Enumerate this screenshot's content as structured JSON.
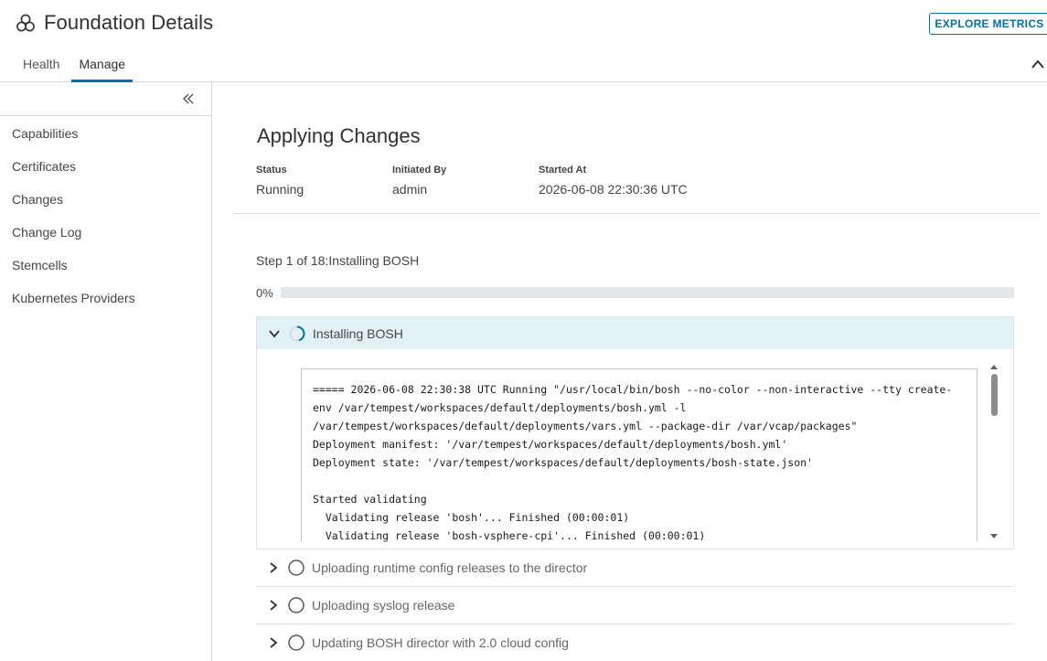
{
  "header": {
    "title": "Foundation Details",
    "explore_label": "EXPLORE METRICS",
    "tabs": [
      {
        "label": "Health",
        "active": false
      },
      {
        "label": "Manage",
        "active": true
      }
    ]
  },
  "sidebar": {
    "items": [
      {
        "label": "Capabilities"
      },
      {
        "label": "Certificates"
      },
      {
        "label": "Changes"
      },
      {
        "label": "Change Log"
      },
      {
        "label": "Stemcells"
      },
      {
        "label": "Kubernetes Providers"
      }
    ]
  },
  "main": {
    "title": "Applying Changes",
    "status_label": "Status",
    "status_value": "Running",
    "initiated_label": "Initiated By",
    "initiated_value": "admin",
    "started_label": "Started At",
    "started_value": "2026-06-08 22:30:36 UTC",
    "step_text": "Step 1 of 18:Installing BOSH",
    "progress_label": "0%",
    "progress_fraction": 0
  },
  "steps": {
    "active": {
      "label": "Installing BOSH",
      "status_icon": "spinner-icon",
      "log_lines": [
        "===== 2026-06-08 22:30:38 UTC Running \"/usr/local/bin/bosh --no-color --non-interactive --tty create-",
        "env /var/tempest/workspaces/default/deployments/bosh.yml -l",
        "/var/tempest/workspaces/default/deployments/vars.yml --package-dir /var/vcap/packages\"",
        "Deployment manifest: '/var/tempest/workspaces/default/deployments/bosh.yml'",
        "Deployment state: '/var/tempest/workspaces/default/deployments/bosh-state.json'",
        "",
        "Started validating",
        "  Validating release 'bosh'... Finished (00:00:01)",
        "  Validating release 'bosh-vsphere-cpi'... Finished (00:00:01)"
      ]
    },
    "pending": [
      {
        "label": "Uploading runtime config releases to the director"
      },
      {
        "label": "Uploading syslog release"
      },
      {
        "label": "Updating BOSH director with 2.0 cloud config"
      }
    ]
  },
  "colors": {
    "accent": "#0072a3",
    "active_step_bg": "#e1f1f6",
    "progress_track": "#e3e6e8"
  }
}
